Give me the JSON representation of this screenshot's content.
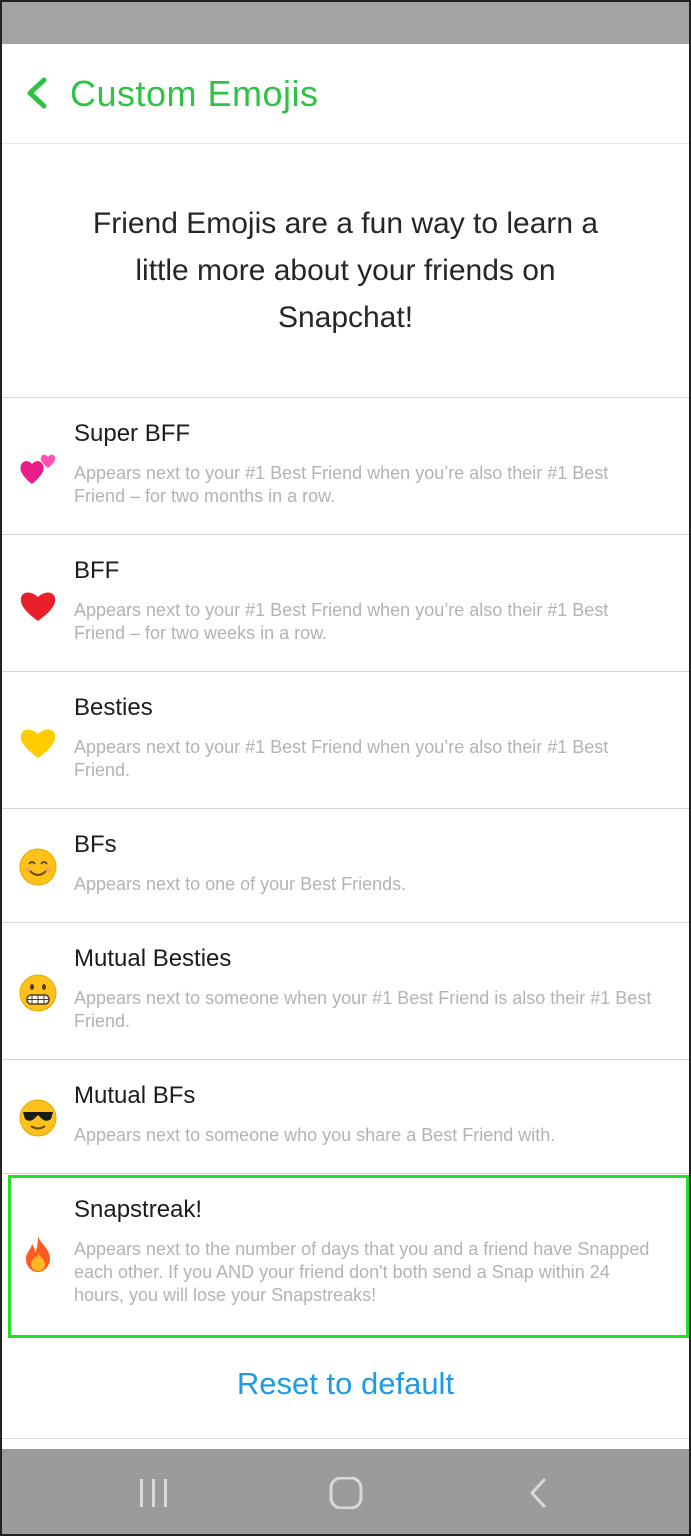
{
  "header": {
    "title": "Custom Emojis",
    "back_icon": "chevron-left-icon"
  },
  "intro": {
    "text": "Friend Emojis are a fun way to learn a little more about your friends on Snapchat!"
  },
  "emojis": [
    {
      "key": "super-bff",
      "icon": "two-hearts-icon",
      "title": "Super BFF",
      "desc": "Appears next to your #1 Best Friend when you’re also their #1 Best Friend – for two months in a row."
    },
    {
      "key": "bff",
      "icon": "red-heart-icon",
      "title": "BFF",
      "desc": "Appears next to your #1 Best Friend when you’re also their #1 Best Friend – for two weeks in a row."
    },
    {
      "key": "besties",
      "icon": "yellow-heart-icon",
      "title": "Besties",
      "desc": "Appears next to your #1 Best Friend when you’re also their #1 Best Friend."
    },
    {
      "key": "bfs",
      "icon": "smiling-face-icon",
      "title": "BFs",
      "desc": "Appears next to one of your Best Friends."
    },
    {
      "key": "mutual-besties",
      "icon": "grimacing-face-icon",
      "title": "Mutual Besties",
      "desc": "Appears next to someone when your #1 Best Friend is also their #1 Best Friend."
    },
    {
      "key": "mutual-bfs",
      "icon": "sunglasses-face-icon",
      "title": "Mutual BFs",
      "desc": "Appears next to someone who you share a Best Friend with."
    },
    {
      "key": "snapstreak",
      "icon": "fire-icon",
      "title": "Snapstreak!",
      "desc": "Appears next to the number of days that you and a friend have Snapped each other. If you AND your friend don't both send a Snap within 24 hours, you will lose your Snapstreaks!"
    }
  ],
  "reset": {
    "label": "Reset to default"
  },
  "nav": {
    "recents_icon": "recent-apps-icon",
    "home_icon": "home-icon",
    "back_icon": "back-icon"
  },
  "colors": {
    "accent_green": "#2fc244",
    "link_blue": "#1d9be6",
    "highlight_green": "#23e023",
    "description_gray": "#b3b3b3"
  }
}
